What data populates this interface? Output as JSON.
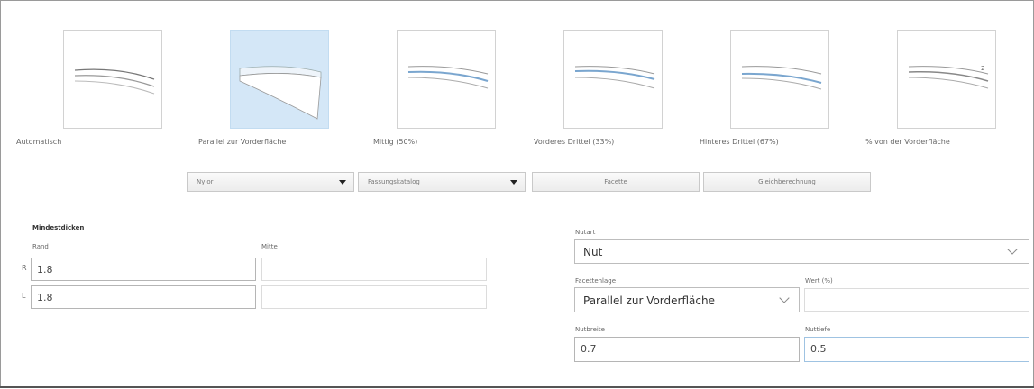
{
  "bevels": [
    {
      "label": "Automatisch",
      "selected": false
    },
    {
      "label": "Parallel zur Vorderfläche",
      "selected": true
    },
    {
      "label": "Mittig (50%)",
      "selected": false
    },
    {
      "label": "Vorderes Drittel (33%)",
      "selected": false
    },
    {
      "label": "Hinteres Drittel (67%)",
      "selected": false
    },
    {
      "label": "% von der Vorderfläche",
      "selected": false
    }
  ],
  "toolbar": {
    "material": "Nylor",
    "catalog": "Fassungskatalog",
    "facette_button": "Facette",
    "gleich_button": "Gleichberechnung"
  },
  "min_thickness": {
    "title": "Mindestdicken",
    "col_rand": "Rand",
    "col_mitte": "Mitte",
    "rows": [
      {
        "side": "R",
        "rand": "1.8",
        "mitte": ""
      },
      {
        "side": "L",
        "rand": "1.8",
        "mitte": ""
      }
    ]
  },
  "groove": {
    "nutart_label": "Nutart",
    "nutart_value": "Nut",
    "facettenlage_label": "Facettenlage",
    "facettenlage_value": "Parallel zur Vorderfläche",
    "wert_label": "Wert (%)",
    "wert_value": "",
    "nutbreite_label": "Nutbreite",
    "nutbreite_value": "0.7",
    "nuttiefe_label": "Nuttiefe",
    "nuttiefe_value": "0.5"
  }
}
